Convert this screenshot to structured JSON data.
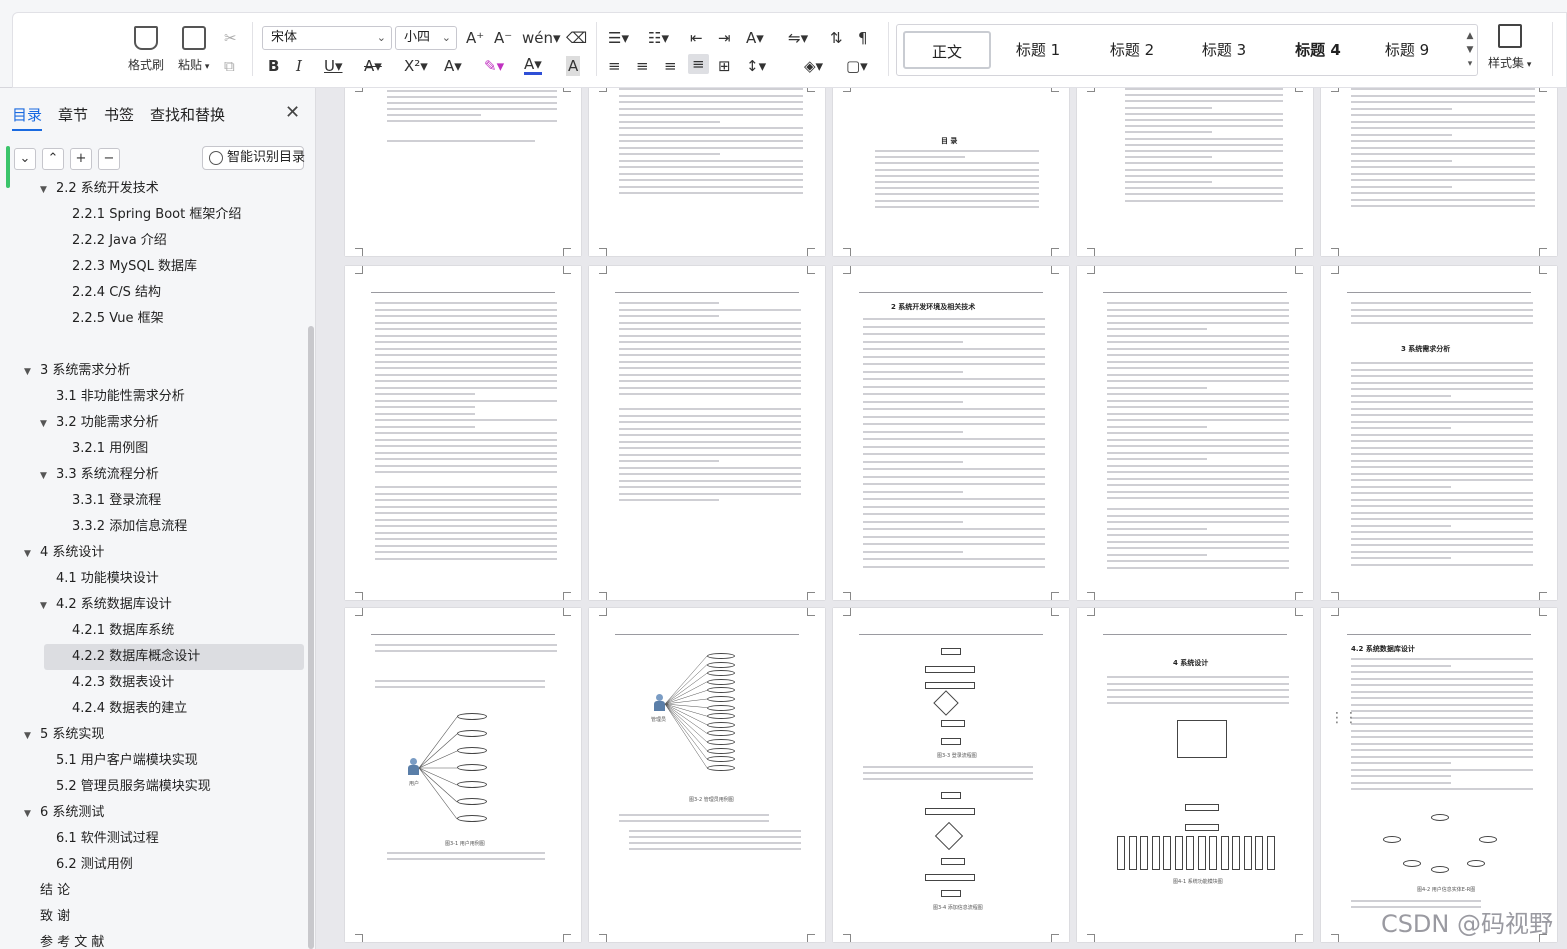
{
  "ribbon": {
    "format_painter": "格式刷",
    "paste": "粘贴",
    "font_name": "宋体",
    "font_size": "小四",
    "styles": [
      {
        "label": "正文",
        "active": true,
        "bold": false
      },
      {
        "label": "标题 1",
        "active": false,
        "bold": false
      },
      {
        "label": "标题 2",
        "active": false,
        "bold": false
      },
      {
        "label": "标题 3",
        "active": false,
        "bold": false
      },
      {
        "label": "标题 4",
        "active": false,
        "bold": true
      },
      {
        "label": "标题 9",
        "active": false,
        "bold": false
      }
    ],
    "style_set": "样式集",
    "accent_color": "#1a6ae0",
    "font_color": "#2f4fd6"
  },
  "nav": {
    "tabs": [
      "目录",
      "章节",
      "书签",
      "查找和替换"
    ],
    "active_tab": "目录",
    "smart_toc": "智能识别目录",
    "toc": [
      {
        "label": "2.2  系统开发技术",
        "level": 2,
        "arrow": "down"
      },
      {
        "label": "2.2.1 Spring Boot 框架介绍",
        "level": 3
      },
      {
        "label": "2.2.2 Java 介绍",
        "level": 3
      },
      {
        "label": "2.2.3 MySQL 数据库",
        "level": 3
      },
      {
        "label": "2.2.4 C/S 结构",
        "level": 3
      },
      {
        "label": "2.2.5 Vue 框架",
        "level": 3
      },
      {
        "label": "",
        "level": 0
      },
      {
        "label": "3    系统需求分析",
        "level": 1,
        "arrow": "down"
      },
      {
        "label": "3.1  非功能性需求分析",
        "level": 2
      },
      {
        "label": "3.2  功能需求分析",
        "level": 2,
        "arrow": "down"
      },
      {
        "label": "3.2.1 用例图",
        "level": 3
      },
      {
        "label": "3.3  系统流程分析",
        "level": 2,
        "arrow": "down"
      },
      {
        "label": "3.3.1   登录流程",
        "level": 3
      },
      {
        "label": "3.3.2   添加信息流程",
        "level": 3
      },
      {
        "label": "4    系统设计",
        "level": 1,
        "arrow": "down"
      },
      {
        "label": "4.1  功能模块设计",
        "level": 2
      },
      {
        "label": "4.2  系统数据库设计",
        "level": 2,
        "arrow": "down"
      },
      {
        "label": "4.2.1   数据库系统",
        "level": 3
      },
      {
        "label": "4.2.2   数据库概念设计",
        "level": 3,
        "selected": true
      },
      {
        "label": "4.2.3   数据表设计",
        "level": 3
      },
      {
        "label": "4.2.4   数据表的建立",
        "level": 3
      },
      {
        "label": "5    系统实现",
        "level": 1,
        "arrow": "down"
      },
      {
        "label": "5.1 用户客户端模块实现",
        "level": 2
      },
      {
        "label": "5.2 管理员服务端模块实现",
        "level": 2
      },
      {
        "label": "6    系统测试",
        "level": 1,
        "arrow": "down"
      },
      {
        "label": "6.1 软件测试过程",
        "level": 2
      },
      {
        "label": "6.2 测试用例",
        "level": 2
      },
      {
        "label": "结      论",
        "level": 0
      },
      {
        "label": "致      谢",
        "level": 0
      },
      {
        "label": "参 考 文 献",
        "level": 0
      }
    ]
  },
  "pages": {
    "toc_title": "目  录",
    "p8_heading": "2   系统开发环境及相关技术",
    "p13_heading": "4   系统设计",
    "p10_heading": "3   系统需求分析",
    "p14_heading": "4.2 系统数据库设计",
    "fig_user_usecase": "图3-1 用户用例图",
    "fig_admin_usecase": "图3-2 管理员用例图",
    "fig_login_flow": "图3-3 登录流程图",
    "fig_add_flow": "图3-4 添加信息流程图",
    "fig_module": "图4-1 系统功能模块图",
    "fig_er": "图4-2 用户信息实体E-R图",
    "actor_user": "用户",
    "actor_admin": "管理员"
  },
  "watermark": "CSDN @码视野"
}
